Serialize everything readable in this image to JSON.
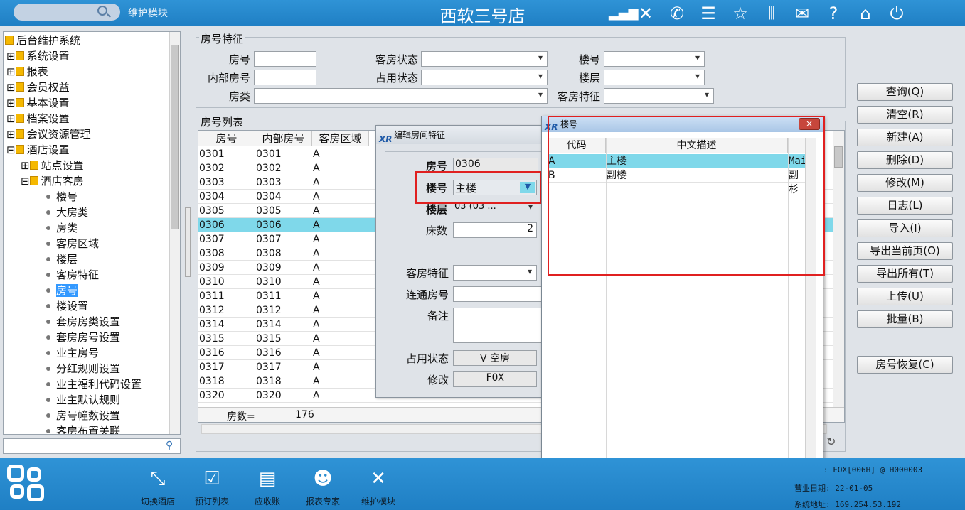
{
  "topbar": {
    "module_label": "维护模块",
    "hotel_name": "西软三号店",
    "icons": [
      "signal-icon",
      "tools-icon",
      "phone-icon",
      "menu-icon",
      "star-icon",
      "columns-icon",
      "mail-icon",
      "help-icon",
      "home-icon",
      "power-icon"
    ]
  },
  "tree": {
    "root": "后台维护系统",
    "groups": [
      "系统设置",
      "报表",
      "会员权益",
      "基本设置",
      "档案设置",
      "会议资源管理",
      "酒店设置"
    ],
    "sub_groups": [
      "站点设置",
      "酒店客房"
    ],
    "leaves": [
      "楼号",
      "大房类",
      "房类",
      "客房区域",
      "楼层",
      "客房特征",
      "房号",
      "楼设置",
      "套房房类设置",
      "套房房号设置",
      "业主房号",
      "分红规则设置",
      "业主福利代码设置",
      "业主默认规则",
      "房号幢数设置",
      "客房布置关联"
    ],
    "selected": "房号"
  },
  "filter": {
    "legend": "房号特征",
    "room_no": "房号",
    "internal_no": "内部房号",
    "room_type": "房类",
    "room_status": "客房状态",
    "occupancy_status": "占用状态",
    "building": "楼号",
    "floor": "楼层",
    "room_feature": "客房特征"
  },
  "grid": {
    "legend": "房号列表",
    "headers": [
      "房号",
      "内部房号",
      "客房区域"
    ],
    "rows": [
      [
        "0301",
        "0301",
        "A"
      ],
      [
        "0302",
        "0302",
        "A"
      ],
      [
        "0303",
        "0303",
        "A"
      ],
      [
        "0304",
        "0304",
        "A"
      ],
      [
        "0305",
        "0305",
        "A"
      ],
      [
        "0306",
        "0306",
        "A"
      ],
      [
        "0307",
        "0307",
        "A"
      ],
      [
        "0308",
        "0308",
        "A"
      ],
      [
        "0309",
        "0309",
        "A"
      ],
      [
        "0310",
        "0310",
        "A"
      ],
      [
        "0311",
        "0311",
        "A"
      ],
      [
        "0312",
        "0312",
        "A"
      ],
      [
        "0314",
        "0314",
        "A"
      ],
      [
        "0315",
        "0315",
        "A"
      ],
      [
        "0316",
        "0316",
        "A"
      ],
      [
        "0317",
        "0317",
        "A"
      ],
      [
        "0318",
        "0318",
        "A"
      ],
      [
        "0320",
        "0320",
        "A"
      ]
    ],
    "selected_row": "0306",
    "count_label": "房数=",
    "count": "176"
  },
  "buttons": [
    "查询(Q)",
    "清空(R)",
    "新建(A)",
    "删除(D)",
    "修改(M)",
    "日志(L)",
    "导入(I)",
    "导出当前页(O)",
    "导出所有(T)",
    "上传(U)",
    "批量(B)",
    "房号恢复(C)"
  ],
  "dialog": {
    "title": "编辑房间特征",
    "room_no_label": "房号",
    "room_no": "0306",
    "building_label": "楼号",
    "building": "主楼",
    "floor_label": "楼层",
    "floor": "03  (03 ...",
    "beds_label": "床数",
    "beds": "2",
    "feature_label": "客房特征",
    "connect_label": "连通房号",
    "remark_label": "备注",
    "occupancy_label": "占用状态",
    "occupancy": "V  空房",
    "modify_label": "修改",
    "modify": "FOX"
  },
  "popup": {
    "title": "楼号",
    "close": "×",
    "headers": [
      "代码",
      "中文描述"
    ],
    "rows": [
      [
        "A",
        "主楼",
        "Mai"
      ],
      [
        "B",
        "副楼",
        "副杉"
      ]
    ]
  },
  "bottombar": {
    "items": [
      "切换酒店",
      "预订列表",
      "应收账",
      "报表专家",
      "维护模块"
    ],
    "status": [
      ": FOX[006H] @ H000003",
      "营业日期: 22-01-05",
      "系统地址: 169.254.53.192"
    ]
  }
}
